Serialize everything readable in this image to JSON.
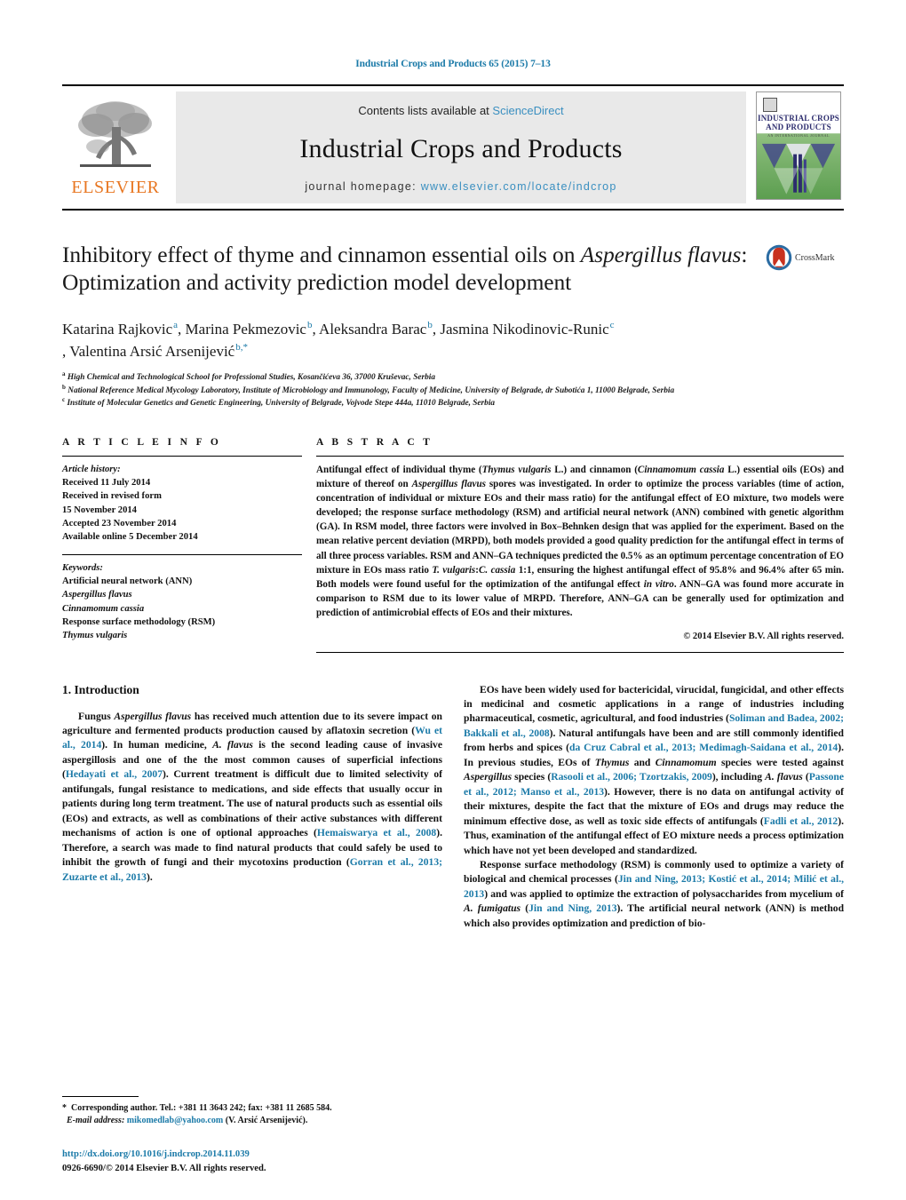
{
  "running_head": "Industrial Crops and Products 65 (2015) 7–13",
  "masthead": {
    "contents_prefix": "Contents lists available at ",
    "sciencedirect": "ScienceDirect",
    "journal_name": "Industrial Crops and Products",
    "homepage_prefix": "journal homepage: ",
    "homepage_url": "www.elsevier.com/locate/indcrop",
    "publisher_wordmark": "ELSEVIER",
    "publisher_logo_icon": "elsevier-tree-icon",
    "cover_title_line1": "INDUSTRIAL CROPS",
    "cover_title_line2": "AND PRODUCTS",
    "cover_subtitle": "AN INTERNATIONAL JOURNAL"
  },
  "article": {
    "title_part1": "Inhibitory effect of thyme and cinnamon essential oils on ",
    "title_italic1": "Aspergillus",
    "title_italic2": "flavus",
    "title_part2": ": Optimization and activity prediction model development",
    "crossmark_label": "CrossMark",
    "crossmark_icon": "crossmark-badge-icon",
    "authors": [
      {
        "name": "Katarina Rajkovic",
        "sup": "a"
      },
      {
        "name": "Marina Pekmezovic",
        "sup": "b"
      },
      {
        "name": "Aleksandra Barac",
        "sup": "b"
      },
      {
        "name": "Jasmina Nikodinovic-Runic",
        "sup": "c"
      },
      {
        "name": "Valentina Arsić Arsenijević",
        "sup": "b,*"
      }
    ],
    "affiliations": [
      {
        "sup": "a",
        "text": "High Chemical and Technological School for Professional Studies, Kosančićeva 36, 37000 Kruševac, Serbia"
      },
      {
        "sup": "b",
        "text": "National Reference Medical Mycology Laboratory, Institute of Microbiology and Immunology, Faculty of Medicine, University of Belgrade, dr Subotića 1, 11000 Belgrade, Serbia"
      },
      {
        "sup": "c",
        "text": "Institute of Molecular Genetics and Genetic Engineering, University of Belgrade, Vojvode Stepe 444a, 11010 Belgrade, Serbia"
      }
    ]
  },
  "article_info": {
    "heading": "A R T I C L E  I N F O",
    "history_label": "Article history:",
    "history": [
      "Received 11 July 2014",
      "Received in revised form",
      "15 November 2014",
      "Accepted 23 November 2014",
      "Available online 5 December 2014"
    ],
    "keywords_label": "Keywords:",
    "keywords": [
      "Artificial neural network (ANN)",
      "Aspergillus flavus",
      "Cinnamomum cassia",
      "Response surface methodology (RSM)",
      "Thymus vulgaris"
    ]
  },
  "abstract": {
    "heading": "A B S T R A C T",
    "text": "Antifungal effect of individual thyme (Thymus vulgaris L.) and cinnamon (Cinnamomum cassia L.) essential oils (EOs) and mixture of thereof on Aspergillus flavus spores was investigated. In order to optimize the process variables (time of action, concentration of individual or mixture EOs and their mass ratio) for the antifungal effect of EO mixture, two models were developed; the response surface methodology (RSM) and artificial neural network (ANN) combined with genetic algorithm (GA). In RSM model, three factors were involved in Box–Behnken design that was applied for the experiment. Based on the mean relative percent deviation (MRPD), both models provided a good quality prediction for the antifungal effect in terms of all three process variables. RSM and ANN–GA techniques predicted the 0.5% as an optimum percentage concentration of EO mixture in EOs mass ratio T. vulgaris:C. cassia 1:1, ensuring the highest antifungal effect of 95.8% and 96.4% after 65 min. Both models were found useful for the optimization of the antifungal effect in vitro. ANN–GA was found more accurate in comparison to RSM due to its lower value of MRPD. Therefore, ANN–GA can be generally used for optimization and prediction of antimicrobial effects of EOs and their mixtures.",
    "copyright": "© 2014 Elsevier B.V. All rights reserved."
  },
  "introduction": {
    "heading": "1.  Introduction",
    "left_para1": "Fungus Aspergillus flavus has received much attention due to its severe impact on agriculture and fermented products production caused by aflatoxin secretion (Wu et al., 2014). In human medicine, A. flavus is the second leading cause of invasive aspergillosis and one of the the most common causes of superficial infections (Hedayati et al., 2007). Current treatment is difficult due to limited selectivity of antifungals, fungal resistance to medications, and side effects that usually occur in patients during long term treatment. The use of natural products such as essential oils (EOs) and extracts, as well as combinations of their active substances with different mechanisms of action is one of optional approaches (Hemaiswarya et al., 2008). Therefore, a search was made to find natural products that could safely be used to inhibit the growth of fungi and their mycotoxins production (Gorran et al., 2013; Zuzarte et al., 2013).",
    "right_para1": "EOs have been widely used for bactericidal, virucidal, fungicidal, and other effects in medicinal and cosmetic applications in a range of industries including pharmaceutical, cosmetic, agricultural, and food industries (Soliman and Badea, 2002; Bakkali et al., 2008). Natural antifungals have been and are still commonly identified from herbs and spices (da Cruz Cabral et al., 2013; Medimagh-Saidana et al., 2014). In previous studies, EOs of Thymus and Cinnamomum species were tested against Aspergillus species (Rasooli et al., 2006; Tzortzakis, 2009), including A. flavus (Passone et al., 2012; Manso et al., 2013). However, there is no data on antifungal activity of their mixtures, despite the fact that the mixture of EOs and drugs may reduce the minimum effective dose, as well as toxic side effects of antifungals (Fadli et al., 2012). Thus, examination of the antifungal effect of EO mixture needs a process optimization which have not yet been developed and standardized.",
    "right_para2": "Response surface methodology (RSM) is commonly used to optimize a variety of biological and chemical processes (Jin and Ning, 2013; Kostić et al., 2014; Milić et al., 2013) and was applied to optimize the extraction of polysaccharides from mycelium of A. fumigatus (Jin and Ning, 2013). The artificial neural network (ANN) is method which also provides optimization and prediction of bio-"
  },
  "footer": {
    "corresponding_marker": "*",
    "corresponding_text": "Corresponding author. Tel.: +381 11 3643 242; fax: +381 11 2685 584.",
    "email_label": "E-mail address:",
    "email": "mikomedlab@yahoo.com",
    "email_owner": "(V. Arsić Arsenijević).",
    "doi": "http://dx.doi.org/10.1016/j.indcrop.2014.11.039",
    "issn_line": "0926-6690/© 2014 Elsevier B.V. All rights reserved."
  },
  "colors": {
    "link_blue": "#1b7aa8",
    "sd_blue": "#3a8fc0",
    "elsevier_orange": "#E87722",
    "masthead_grey": "#e9e9e9"
  }
}
